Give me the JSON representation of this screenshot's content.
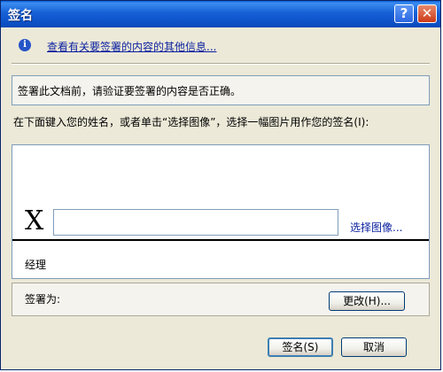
{
  "window": {
    "title": "签名"
  },
  "info": {
    "link_text": "查看有关要签署的内容的其他信息..."
  },
  "verify": {
    "text": "签署此文档前，请验证要签署的内容是否正确。"
  },
  "prompt": {
    "text": "在下面键入您的姓名，或者单击“选择图像”，选择一幅图片用作您的签名(I):"
  },
  "signature": {
    "x_mark": "X",
    "name_value": "",
    "select_image_label": "选择图像...",
    "signer_title": "经理"
  },
  "sign_as": {
    "label": "签署为:",
    "change_button": "更改(H)..."
  },
  "buttons": {
    "sign": "签名(S)",
    "cancel": "取消"
  },
  "title_buttons": {
    "help": "?",
    "close": "✕"
  }
}
